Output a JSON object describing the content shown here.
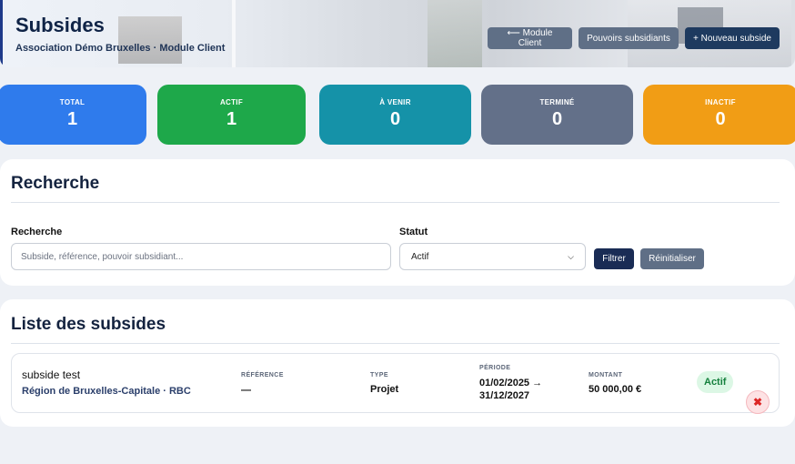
{
  "header": {
    "title": "Subsides",
    "subtitle": "Association Démo Bruxelles · Module Client",
    "buttons": {
      "back": "⟵ Module Client",
      "funders": "Pouvoirs subsidiants",
      "new": "+ Nouveau subside"
    }
  },
  "stats": [
    {
      "label": "TOTAL",
      "value": "1",
      "color": "#2f7bec"
    },
    {
      "label": "ACTIF",
      "value": "1",
      "color": "#1ea84a"
    },
    {
      "label": "À VENIR",
      "value": "0",
      "color": "#1592a8"
    },
    {
      "label": "TERMINÉ",
      "value": "0",
      "color": "#637089"
    },
    {
      "label": "INACTIF",
      "value": "0",
      "color": "#f19d15"
    }
  ],
  "search": {
    "heading": "Recherche",
    "query_label": "Recherche",
    "query_placeholder": "Subside, référence, pouvoir subsidiant...",
    "status_label": "Statut",
    "status_value": "Actif",
    "filter_button": "Filtrer",
    "reset_button": "Réinitialiser"
  },
  "list": {
    "heading": "Liste des subsides",
    "columns": {
      "reference": "RÉFÉRENCE",
      "type": "TYPE",
      "period": "PÉRIODE",
      "amount": "MONTANT"
    },
    "items": [
      {
        "name": "subside test",
        "funder": "Région de Bruxelles-Capitale · RBC",
        "reference": "—",
        "type": "Projet",
        "period_start": "01/02/2025 →",
        "period_end": "31/12/2027",
        "amount": "50 000,00 €",
        "status": "Actif"
      }
    ]
  },
  "icons": {
    "delete": "close-icon"
  }
}
